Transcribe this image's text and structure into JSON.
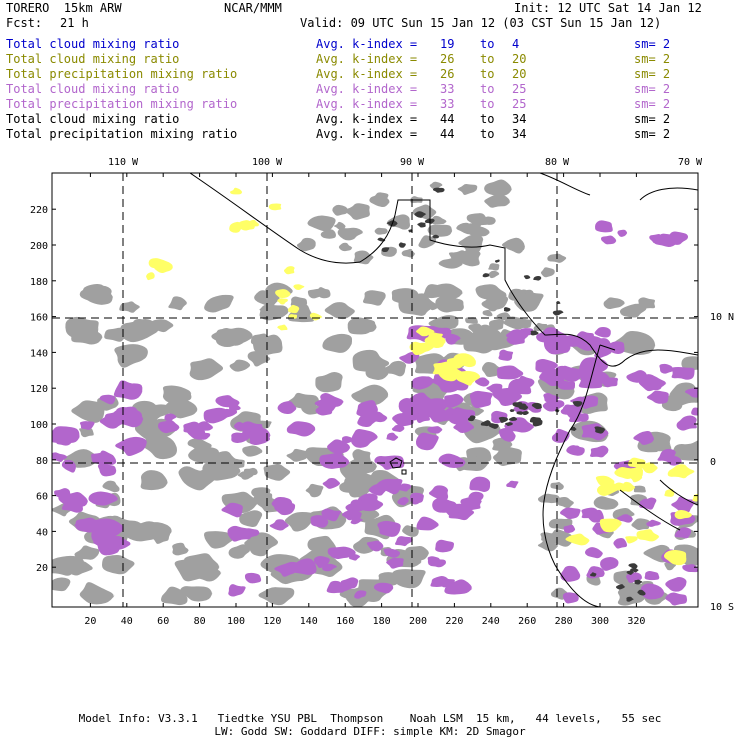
{
  "header": {
    "model": "TORERO  15km ARW",
    "org": "NCAR/MMM",
    "init": "Init: 12 UTC Sat 14 Jan 12",
    "fcst_label": "Fcst:",
    "fcst_value": "21 h",
    "valid": "Valid: 09 UTC Sun 15 Jan 12 (03 CST Sun 15 Jan 12)"
  },
  "legend": [
    {
      "field": "Total cloud mixing ratio",
      "index": "Avg. k-index =",
      "hi": "19",
      "to": "to",
      "lo": "4",
      "sm": "sm= 2",
      "color": "#0000cc"
    },
    {
      "field": "Total cloud mixing ratio",
      "index": "Avg. k-index =",
      "hi": "26",
      "to": "to",
      "lo": "20",
      "sm": "sm= 2",
      "color": "#8a8a00"
    },
    {
      "field": "Total precipitation mixing ratio",
      "index": "Avg. k-index =",
      "hi": "26",
      "to": "to",
      "lo": "20",
      "sm": "sm= 2",
      "color": "#8a8a00"
    },
    {
      "field": "Total cloud mixing ratio",
      "index": "Avg. k-index =",
      "hi": "33",
      "to": "to",
      "lo": "25",
      "sm": "sm= 2",
      "color": "#b266cc"
    },
    {
      "field": "Total precipitation mixing ratio",
      "index": "Avg. k-index =",
      "hi": "33",
      "to": "to",
      "lo": "25",
      "sm": "sm= 2",
      "color": "#b266cc"
    },
    {
      "field": "Total cloud mixing ratio",
      "index": "Avg. k-index =",
      "hi": "44",
      "to": "to",
      "lo": "34",
      "sm": "sm= 2",
      "color": "#000000"
    },
    {
      "field": "Total precipitation mixing ratio",
      "index": "Avg. k-index =",
      "hi": "44",
      "to": "to",
      "lo": "34",
      "sm": "sm= 2",
      "color": "#000000"
    }
  ],
  "map": {
    "top_lon_labels": [
      "110 W",
      "100 W",
      "90 W",
      "80 W",
      "70 W"
    ],
    "right_lat_labels": [
      "10 N",
      "0",
      "10 S"
    ],
    "left_grid_labels": [
      "20",
      "40",
      "60",
      "80",
      "100",
      "120",
      "140",
      "160",
      "180",
      "200",
      "220"
    ],
    "bottom_grid_labels": [
      "20",
      "40",
      "60",
      "80",
      "100",
      "120",
      "140",
      "160",
      "180",
      "200",
      "220",
      "240",
      "260",
      "280",
      "300",
      "320"
    ],
    "colors": {
      "cloud_gray": "#a0a0a0",
      "cloud_dark": "#3a3a3a",
      "precip_purple": "#b266cc",
      "precip_yellow": "#ffff66",
      "coast": "#000000"
    }
  },
  "footer": {
    "line1": "Model Info: V3.3.1   Tiedtke YSU PBL  Thompson    Noah LSM  15 km,   44 levels,   55 sec",
    "line2": "LW: Godd SW: Goddard DIFF: simple KM: 2D Smagor"
  }
}
